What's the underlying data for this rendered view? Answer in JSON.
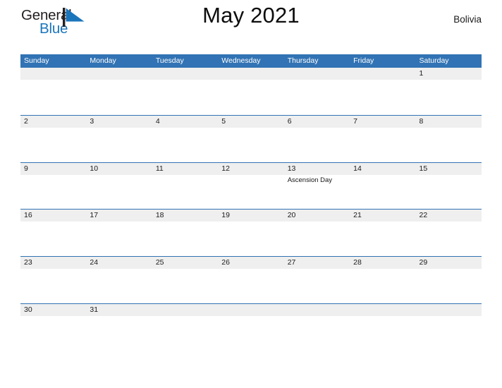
{
  "brand": {
    "logo_text_1": "General",
    "logo_text_2": "Blue",
    "logo_color_dark": "#231f20",
    "logo_color_blue": "#1b75bb"
  },
  "header": {
    "title": "May 2021",
    "country": "Bolivia"
  },
  "theme": {
    "header_bar_color": "#3173b4",
    "row_band_color": "#efefef",
    "row_line_color": "#3173b4"
  },
  "calendar": {
    "month": "May",
    "year": "2021",
    "weekdays": [
      "Sunday",
      "Monday",
      "Tuesday",
      "Wednesday",
      "Thursday",
      "Friday",
      "Saturday"
    ],
    "weeks": [
      [
        {
          "day": ""
        },
        {
          "day": ""
        },
        {
          "day": ""
        },
        {
          "day": ""
        },
        {
          "day": ""
        },
        {
          "day": ""
        },
        {
          "day": "1"
        }
      ],
      [
        {
          "day": "2"
        },
        {
          "day": "3"
        },
        {
          "day": "4"
        },
        {
          "day": "5"
        },
        {
          "day": "6"
        },
        {
          "day": "7"
        },
        {
          "day": "8"
        }
      ],
      [
        {
          "day": "9"
        },
        {
          "day": "10"
        },
        {
          "day": "11"
        },
        {
          "day": "12"
        },
        {
          "day": "13",
          "event": "Ascension Day"
        },
        {
          "day": "14"
        },
        {
          "day": "15"
        }
      ],
      [
        {
          "day": "16"
        },
        {
          "day": "17"
        },
        {
          "day": "18"
        },
        {
          "day": "19"
        },
        {
          "day": "20"
        },
        {
          "day": "21"
        },
        {
          "day": "22"
        }
      ],
      [
        {
          "day": "23"
        },
        {
          "day": "24"
        },
        {
          "day": "25"
        },
        {
          "day": "26"
        },
        {
          "day": "27"
        },
        {
          "day": "28"
        },
        {
          "day": "29"
        }
      ],
      [
        {
          "day": "30"
        },
        {
          "day": "31"
        },
        {
          "day": ""
        },
        {
          "day": ""
        },
        {
          "day": ""
        },
        {
          "day": ""
        },
        {
          "day": ""
        }
      ]
    ]
  }
}
